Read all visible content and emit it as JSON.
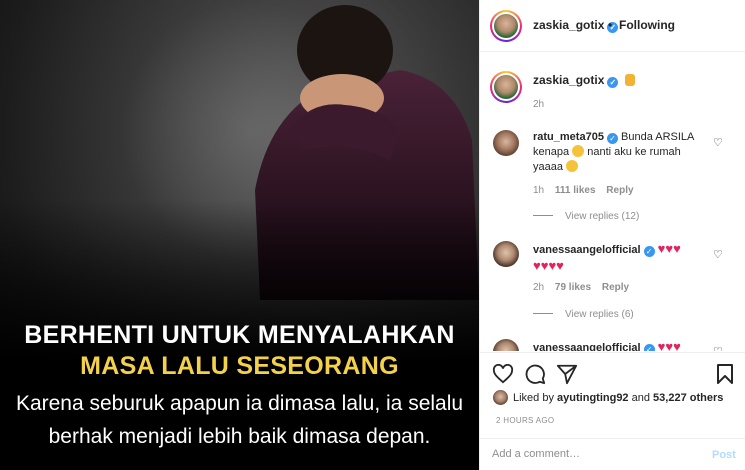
{
  "image_caption": {
    "line1": "BERHENTI UNTUK MENYALAHKAN",
    "line2": "MASA LALU SESEORANG",
    "line3": "Karena seburuk apapun ia dimasa lalu, ia selalu",
    "line4": "berhak menjadi lebih baik dimasa depan."
  },
  "header": {
    "username": "zaskia_gotix",
    "separator": "•",
    "follow_status": "Following"
  },
  "caption_post": {
    "username": "zaskia_gotix",
    "time": "2h"
  },
  "comments": [
    {
      "username": "ratu_meta705",
      "text_part1": "Bunda ARSILA",
      "text_part2": "kenapa",
      "text_part3": "nanti aku ke rumah",
      "text_part4": "yaaaa",
      "time": "1h",
      "likes": "111 likes",
      "reply": "Reply",
      "view_replies": "View replies (12)"
    },
    {
      "username": "vanessaangelofficial",
      "time": "2h",
      "likes": "79 likes",
      "reply": "Reply",
      "view_replies": "View replies (6)"
    },
    {
      "username": "vanessaangelofficial"
    }
  ],
  "likes": {
    "prefix": "Liked by",
    "user": "ayutingting92",
    "conjunction": "and",
    "others": "53,227 others"
  },
  "time_ago": "2 HOURS AGO",
  "comment_box": {
    "placeholder": "Add a comment…",
    "post_label": "Post"
  },
  "colors": {
    "verified": "#3897f0",
    "caption_yellow": "#f3d14a",
    "post_button": "#b3dbff"
  }
}
